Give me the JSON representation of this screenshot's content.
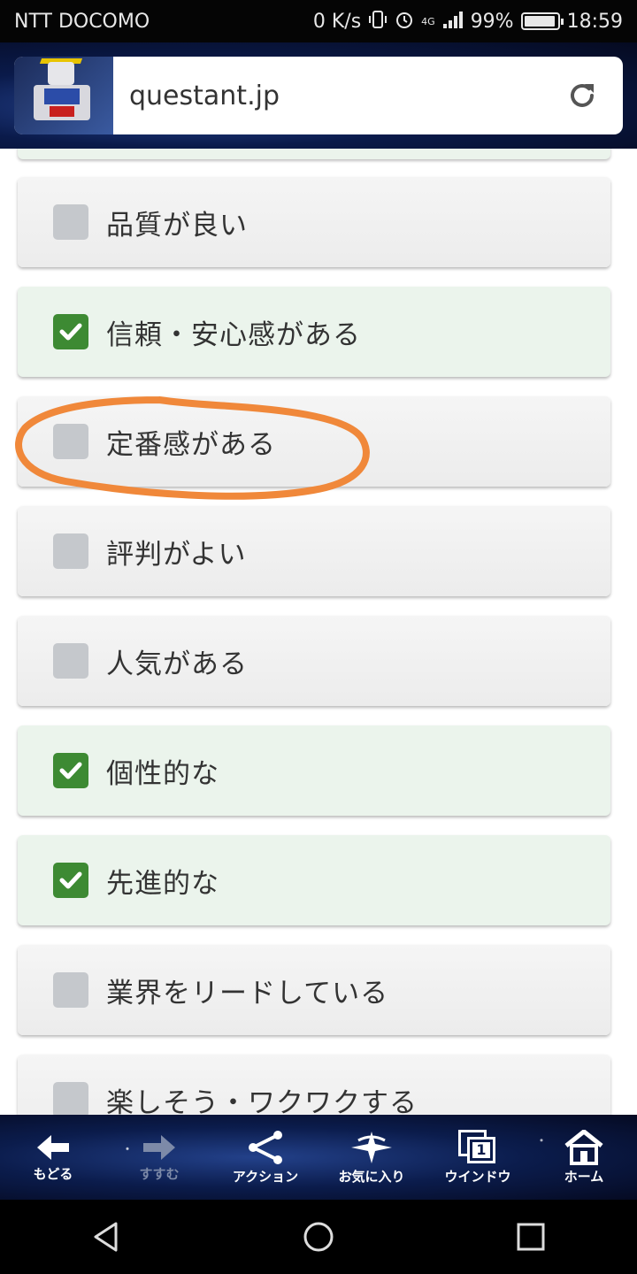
{
  "status_bar": {
    "carrier": "NTT DOCOMO",
    "net_speed": "0 K/s",
    "network": "4G",
    "battery": "99%",
    "time": "18:59"
  },
  "browser": {
    "url": "questant.jp"
  },
  "options": [
    {
      "label": "品質が良い",
      "checked": false
    },
    {
      "label": "信頼・安心感がある",
      "checked": true
    },
    {
      "label": "定番感がある",
      "checked": false
    },
    {
      "label": "評判がよい",
      "checked": false
    },
    {
      "label": "人気がある",
      "checked": false
    },
    {
      "label": "個性的な",
      "checked": true
    },
    {
      "label": "先進的な",
      "checked": true
    },
    {
      "label": "業界をリードしている",
      "checked": false
    },
    {
      "label": "楽しそう・ワクワクする",
      "checked": false
    }
  ],
  "toolbar": {
    "back": "もどる",
    "forward": "すすむ",
    "action": "アクション",
    "favorites": "お気に入り",
    "window": "ウインドウ",
    "window_count": "1",
    "home": "ホーム"
  },
  "colors": {
    "checked_box": "#3d8a33",
    "checked_bg": "#ebf4ec",
    "annotation": "#f0883a"
  }
}
